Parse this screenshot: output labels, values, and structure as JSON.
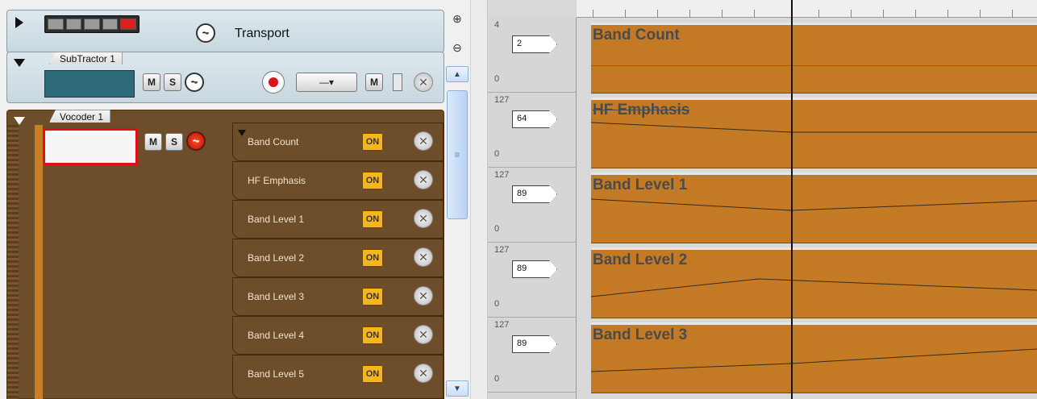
{
  "transport": {
    "label": "Transport"
  },
  "subtractor": {
    "name": "SubTractor 1",
    "mute": "M",
    "solo": "S",
    "mute2": "M",
    "dropdown": "—▾"
  },
  "vocoder": {
    "name": "Vocoder 1",
    "mute": "M",
    "solo": "S",
    "lanes": [
      {
        "name": "Band Count",
        "on": "ON"
      },
      {
        "name": "HF Emphasis",
        "on": "ON"
      },
      {
        "name": "Band Level 1",
        "on": "ON"
      },
      {
        "name": "Band Level 2",
        "on": "ON"
      },
      {
        "name": "Band Level 3",
        "on": "ON"
      },
      {
        "name": "Band Level 4",
        "on": "ON"
      },
      {
        "name": "Band Level 5",
        "on": "ON"
      }
    ]
  },
  "editor": {
    "rows": [
      {
        "max": "4",
        "min": "0",
        "value": "2",
        "title": "Band Count"
      },
      {
        "max": "127",
        "min": "0",
        "value": "64",
        "title": "HF Emphasis"
      },
      {
        "max": "127",
        "min": "0",
        "value": "89",
        "title": "Band Level 1"
      },
      {
        "max": "127",
        "min": "0",
        "value": "89",
        "title": "Band Level 2"
      },
      {
        "max": "127",
        "min": "0",
        "value": "89",
        "title": "Band Level 3"
      }
    ]
  },
  "colors": {
    "clip": "#c47a25",
    "track_brown": "#6e4e2a",
    "on_button": "#f3b719",
    "record": "#d8161a"
  },
  "icons": [
    "zoom-in-icon",
    "zoom-out-icon",
    "scroll-up-icon",
    "scroll-down-icon",
    "record-icon",
    "close-icon",
    "waveform-icon"
  ]
}
